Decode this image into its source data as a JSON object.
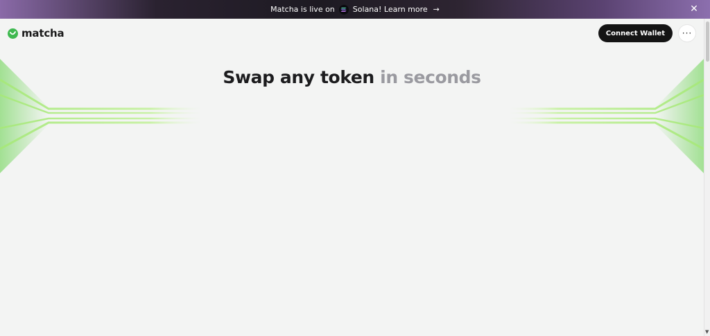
{
  "banner": {
    "text_before": "Matcha is live on",
    "text_after": "Solana! Learn more",
    "link_arrow": "→",
    "close": "✕",
    "icons": {
      "chain": "solana-icon",
      "arrow": "arrow-right-icon",
      "close": "close-icon"
    }
  },
  "header": {
    "logo_text": "matcha",
    "connect_label": "Connect Wallet",
    "more_label": "···"
  },
  "hero": {
    "title_main": "Swap any token",
    "title_muted": "in seconds"
  },
  "colors": {
    "accent_green": "#3fb950",
    "streak_green": "#b8ee8a",
    "button_dark": "#141414",
    "banner_purple": "#8a6aa8"
  }
}
